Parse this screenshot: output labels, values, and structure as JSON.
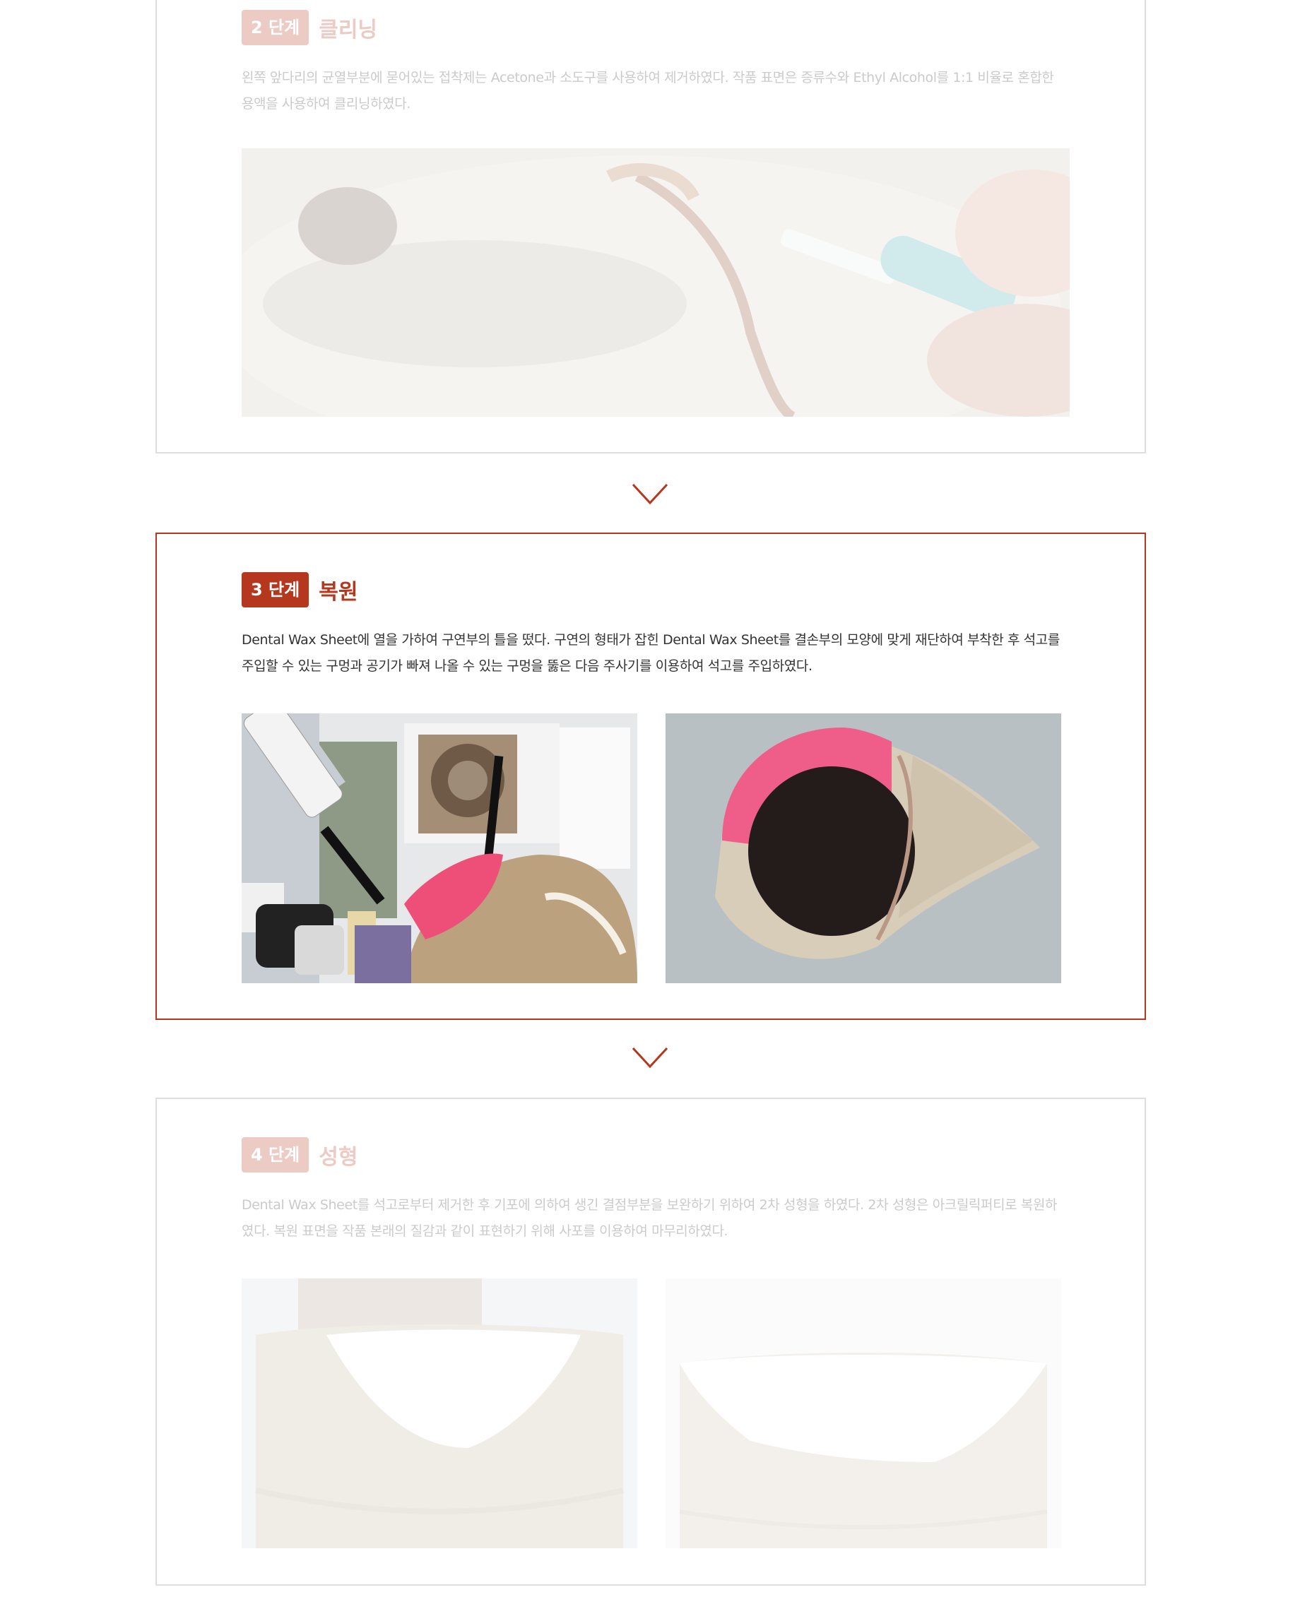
{
  "steps": [
    {
      "badge": "2 단계",
      "title": "클리닝",
      "description": "왼쪽 앞다리의 균열부분에 묻어있는 접착제는 Acetone과 소도구를 사용하여 제거하였다. 작품 표면은 증류수와 Ethyl Alcohol를 1:1 비율로 혼합한 용액을 사용하여 클리닝하였다.",
      "state": "inactive"
    },
    {
      "badge": "3 단계",
      "title": "복원",
      "description": "Dental Wax Sheet에 열을 가하여 구연부의 틀을 떴다. 구연의 형태가 잡힌 Dental Wax Sheet를 결손부의 모양에 맞게 재단하여 부착한 후 석고를 주입할 수 있는 구멍과 공기가 빠져 나올 수 있는 구멍을 뚫은 다음 주사기를 이용하여 석고를 주입하였다.",
      "state": "active"
    },
    {
      "badge": "4 단계",
      "title": "성형",
      "description": "Dental Wax Sheet를 석고로부터 제거한 후 기포에 의하여 생긴 결점부분을 보완하기 위하여 2차 성형을 하였다.  2차 성형은 아크릴릭퍼티로 복원하였다. 복원 표면을 작품 본래의 질감과 같이 표현하기 위해 사포를 이용하여 마무리하였다.",
      "state": "inactive"
    }
  ],
  "icons": {
    "step_arrow": "chevron-down-icon"
  },
  "colors": {
    "accent": "#b5381e",
    "inactive_border": "#dedede",
    "text": "#333333"
  }
}
